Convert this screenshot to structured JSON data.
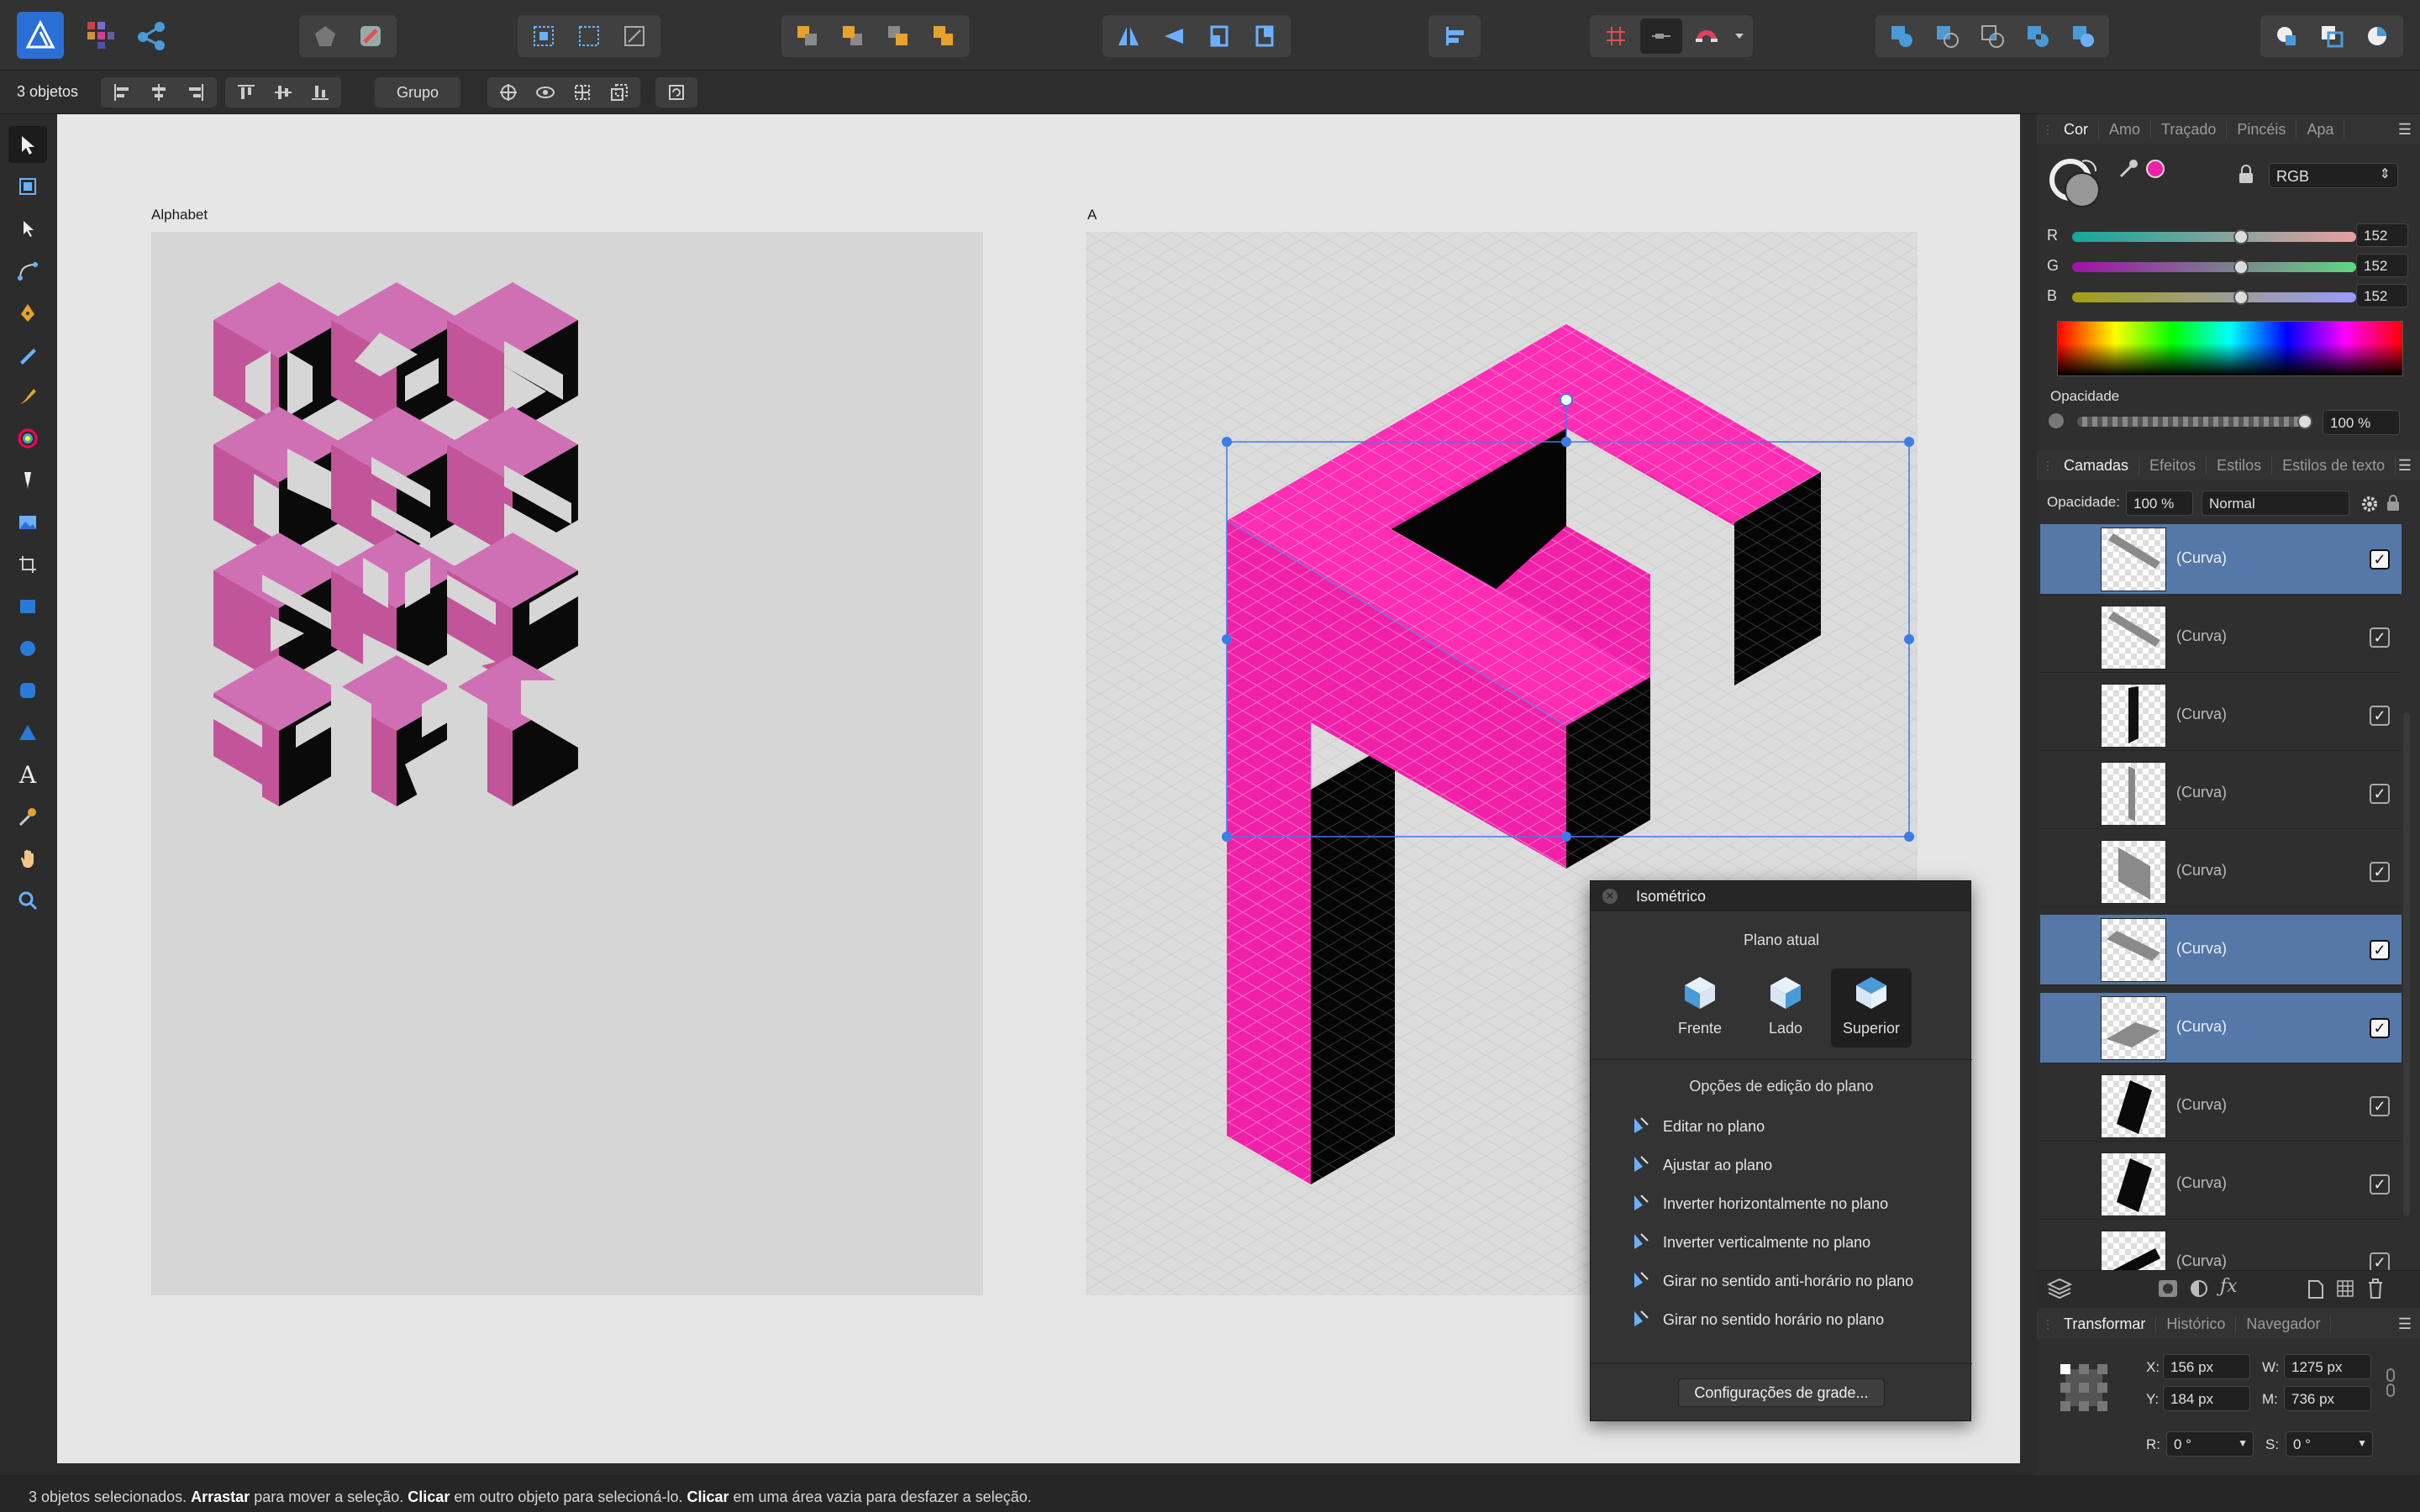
{
  "context": {
    "selection_label": "3 objetos",
    "group_button": "Grupo"
  },
  "tools": [
    {
      "name": "move-tool-icon",
      "on": true
    },
    {
      "name": "artboard-tool-icon"
    },
    {
      "name": "node-tool-icon"
    },
    {
      "name": "corner-tool-icon"
    },
    {
      "name": "pen-tool-icon"
    },
    {
      "name": "pencil-tool-icon"
    },
    {
      "name": "vector-brush-tool-icon"
    },
    {
      "name": "fill-tool-icon"
    },
    {
      "name": "transparency-tool-icon"
    },
    {
      "name": "place-image-tool-icon"
    },
    {
      "name": "crop-tool-icon"
    },
    {
      "name": "rectangle-tool-icon"
    },
    {
      "name": "ellipse-tool-icon"
    },
    {
      "name": "rounded-rectangle-tool-icon"
    },
    {
      "name": "triangle-tool-icon"
    },
    {
      "name": "text-tool-icon",
      "glyph": "A"
    },
    {
      "name": "color-picker-tool-icon"
    },
    {
      "name": "hand-tool-icon"
    },
    {
      "name": "zoom-tool-icon"
    }
  ],
  "canvas": {
    "artboard1_label": "Alphabet",
    "artboard2_label": "A",
    "accent": "#f020a8",
    "letter_color": "#c2559a"
  },
  "color_panel": {
    "tabs": [
      "Cor",
      "Amo",
      "Traçado",
      "Pincéis",
      "Apa"
    ],
    "active_tab": "Cor",
    "mode": "RGB",
    "r_label": "R",
    "g_label": "G",
    "b_label": "B",
    "r": "152",
    "g": "152",
    "b": "152",
    "level": 0.6,
    "opacity_label": "Opacidade",
    "opacity": "100 %",
    "swatch": "#f020a8"
  },
  "layers_panel": {
    "tabs": [
      "Camadas",
      "Efeitos",
      "Estilos",
      "Estilos de texto"
    ],
    "active_tab": "Camadas",
    "opacity_label": "Opacidade:",
    "opacity": "100 %",
    "blend": "Normal",
    "layers": [
      {
        "name": "(Curva)",
        "selected": true,
        "thumb": "gray-diag"
      },
      {
        "name": "(Curva)",
        "selected": false,
        "thumb": "gray-diag"
      },
      {
        "name": "(Curva)",
        "selected": false,
        "thumb": "black-vert"
      },
      {
        "name": "(Curva)",
        "selected": false,
        "thumb": "gray-vert"
      },
      {
        "name": "(Curva)",
        "selected": false,
        "thumb": "gray-block"
      },
      {
        "name": "(Curva)",
        "selected": true,
        "thumb": "gray-diag2"
      },
      {
        "name": "(Curva)",
        "selected": true,
        "thumb": "gray-diag3"
      },
      {
        "name": "(Curva)",
        "selected": false,
        "thumb": "black-block"
      },
      {
        "name": "(Curva)",
        "selected": false,
        "thumb": "black-block"
      },
      {
        "name": "(Curva)",
        "selected": false,
        "thumb": "black-flat"
      }
    ]
  },
  "transform_panel": {
    "tabs": [
      "Transformar",
      "Histórico",
      "Navegador"
    ],
    "active_tab": "Transformar",
    "x_label": "X:",
    "x": "156 px",
    "y_label": "Y:",
    "y": "184 px",
    "w_label": "W:",
    "w": "1275 px",
    "h_label": "M:",
    "h": "736 px",
    "r_label": "R:",
    "r": "0 °",
    "s_label": "S:",
    "s": "0 °"
  },
  "isometric_panel": {
    "title": "Isométrico",
    "current_plane_label": "Plano atual",
    "planes": [
      "Frente",
      "Lado",
      "Superior"
    ],
    "active_plane": "Superior",
    "options_title": "Opções de edição do plano",
    "options": [
      "Editar no plano",
      "Ajustar ao plano",
      "Inverter horizontalmente no plano",
      "Inverter verticalmente no plano",
      "Girar no sentido anti-horário no plano",
      "Girar no sentido horário no plano"
    ],
    "grid_button": "Configurações de grade..."
  },
  "status": {
    "p1": "3 objetos selecionados. ",
    "b1": "Arrastar",
    "p2": " para mover a seleção. ",
    "b2": "Clicar",
    "p3": " em outro objeto para selecioná-lo. ",
    "b3": "Clicar",
    "p4": " em uma área vazia para desfazer a seleção."
  }
}
